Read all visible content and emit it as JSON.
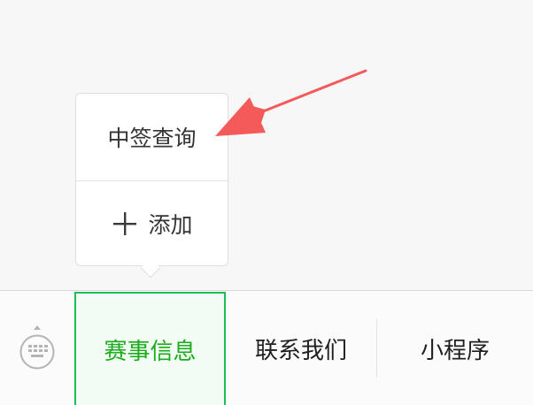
{
  "submenu": {
    "items": [
      {
        "label": "中签查询"
      },
      {
        "label": "添加",
        "icon": "plus-icon"
      }
    ]
  },
  "menu_bar": {
    "keyboard_icon": "keyboard-icon",
    "tabs": [
      {
        "label": "赛事信息",
        "active": true
      },
      {
        "label": "联系我们",
        "active": false
      },
      {
        "label": "小程序",
        "active": false
      }
    ]
  },
  "colors": {
    "accent_green": "#1aad19",
    "active_border": "#1dbd5a",
    "annotation_arrow": "#f55a5a"
  }
}
